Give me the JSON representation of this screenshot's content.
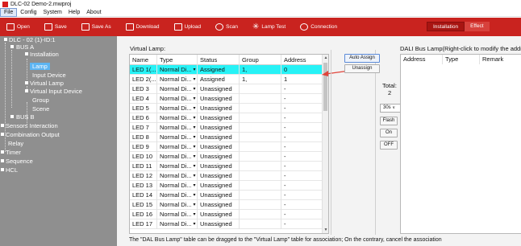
{
  "window": {
    "title": "DLC-02    Demo-2.mwproj"
  },
  "menu": [
    "File",
    "Config",
    "System",
    "Help",
    "About"
  ],
  "toolbar": {
    "open": "Open",
    "save": "Save",
    "save_as": "Save As",
    "download": "Download",
    "upload": "Upload",
    "scan": "Scan",
    "lamp_test": "Lamp Test",
    "connection": "Connection",
    "mode_installation": "Installation",
    "mode_effect": "Effect"
  },
  "tree": {
    "root": "DLC - 02 (1)-ID:1",
    "bus_a": "BUS A",
    "installation": "Installation",
    "lamp": "Lamp",
    "input_device": "Input Device",
    "virtual_lamp": "Virtual Lamp",
    "virtual_input_device": "Virtual Input Device",
    "group": "Group",
    "scene": "Scene",
    "bus_b": "BUS B",
    "sensors_interaction": "Sensors Interaction",
    "combination_output": "Combination Output",
    "relay": "Relay",
    "timer": "Timer",
    "sequence": "Sequence",
    "hcl": "HCL"
  },
  "virtual_lamp": {
    "label": "Virtual Lamp:",
    "columns": [
      "Name",
      "Type",
      "Status",
      "Group",
      "Address"
    ],
    "rows": [
      [
        "LED 1(...",
        "Normal Di...",
        "Assigned",
        "1,",
        "0"
      ],
      [
        "LED 2(...",
        "Normal Di...",
        "Assigned",
        "1,",
        "1"
      ],
      [
        "LED 3",
        "Normal Di...",
        "Unassigned",
        "",
        "-"
      ],
      [
        "LED 4",
        "Normal Di...",
        "Unassigned",
        "",
        "-"
      ],
      [
        "LED 5",
        "Normal Di...",
        "Unassigned",
        "",
        "-"
      ],
      [
        "LED 6",
        "Normal Di...",
        "Unassigned",
        "",
        "-"
      ],
      [
        "LED 7",
        "Normal Di...",
        "Unassigned",
        "",
        "-"
      ],
      [
        "LED 8",
        "Normal Di...",
        "Unassigned",
        "",
        "-"
      ],
      [
        "LED 9",
        "Normal Di...",
        "Unassigned",
        "",
        "-"
      ],
      [
        "LED 10",
        "Normal Di...",
        "Unassigned",
        "",
        "-"
      ],
      [
        "LED 11",
        "Normal Di...",
        "Unassigned",
        "",
        "-"
      ],
      [
        "LED 12",
        "Normal Di...",
        "Unassigned",
        "",
        "-"
      ],
      [
        "LED 13",
        "Normal Di...",
        "Unassigned",
        "",
        "-"
      ],
      [
        "LED 14",
        "Normal Di...",
        "Unassigned",
        "",
        "-"
      ],
      [
        "LED 15",
        "Normal Di...",
        "Unassigned",
        "",
        "-"
      ],
      [
        "LED 16",
        "Normal Di...",
        "Unassigned",
        "",
        "-"
      ],
      [
        "LED 17",
        "Normal Di...",
        "Unassigned",
        "",
        "-"
      ]
    ]
  },
  "controls": {
    "auto_assign": "Auto Assign",
    "unassign": "Unassign",
    "total_label": "Total:",
    "total_value": "2",
    "interval": "30s",
    "flash": "Flash",
    "on": "On",
    "off": "OFF"
  },
  "dali_bus": {
    "label": "DALI Bus Lamp(Right-click to modify the address",
    "columns": [
      "Address",
      "Type",
      "Remark"
    ]
  },
  "footer": "The \"DAL Bus Lamp\" table can be dragged to the \"Virtual Lamp\" table for association; On the contrary, cancel the association",
  "colors": {
    "toolbar": "#c9231f",
    "sidebar": "#8f8f8f",
    "selected_row": "#27f2f6",
    "tree_selected": "#5db5f2"
  }
}
